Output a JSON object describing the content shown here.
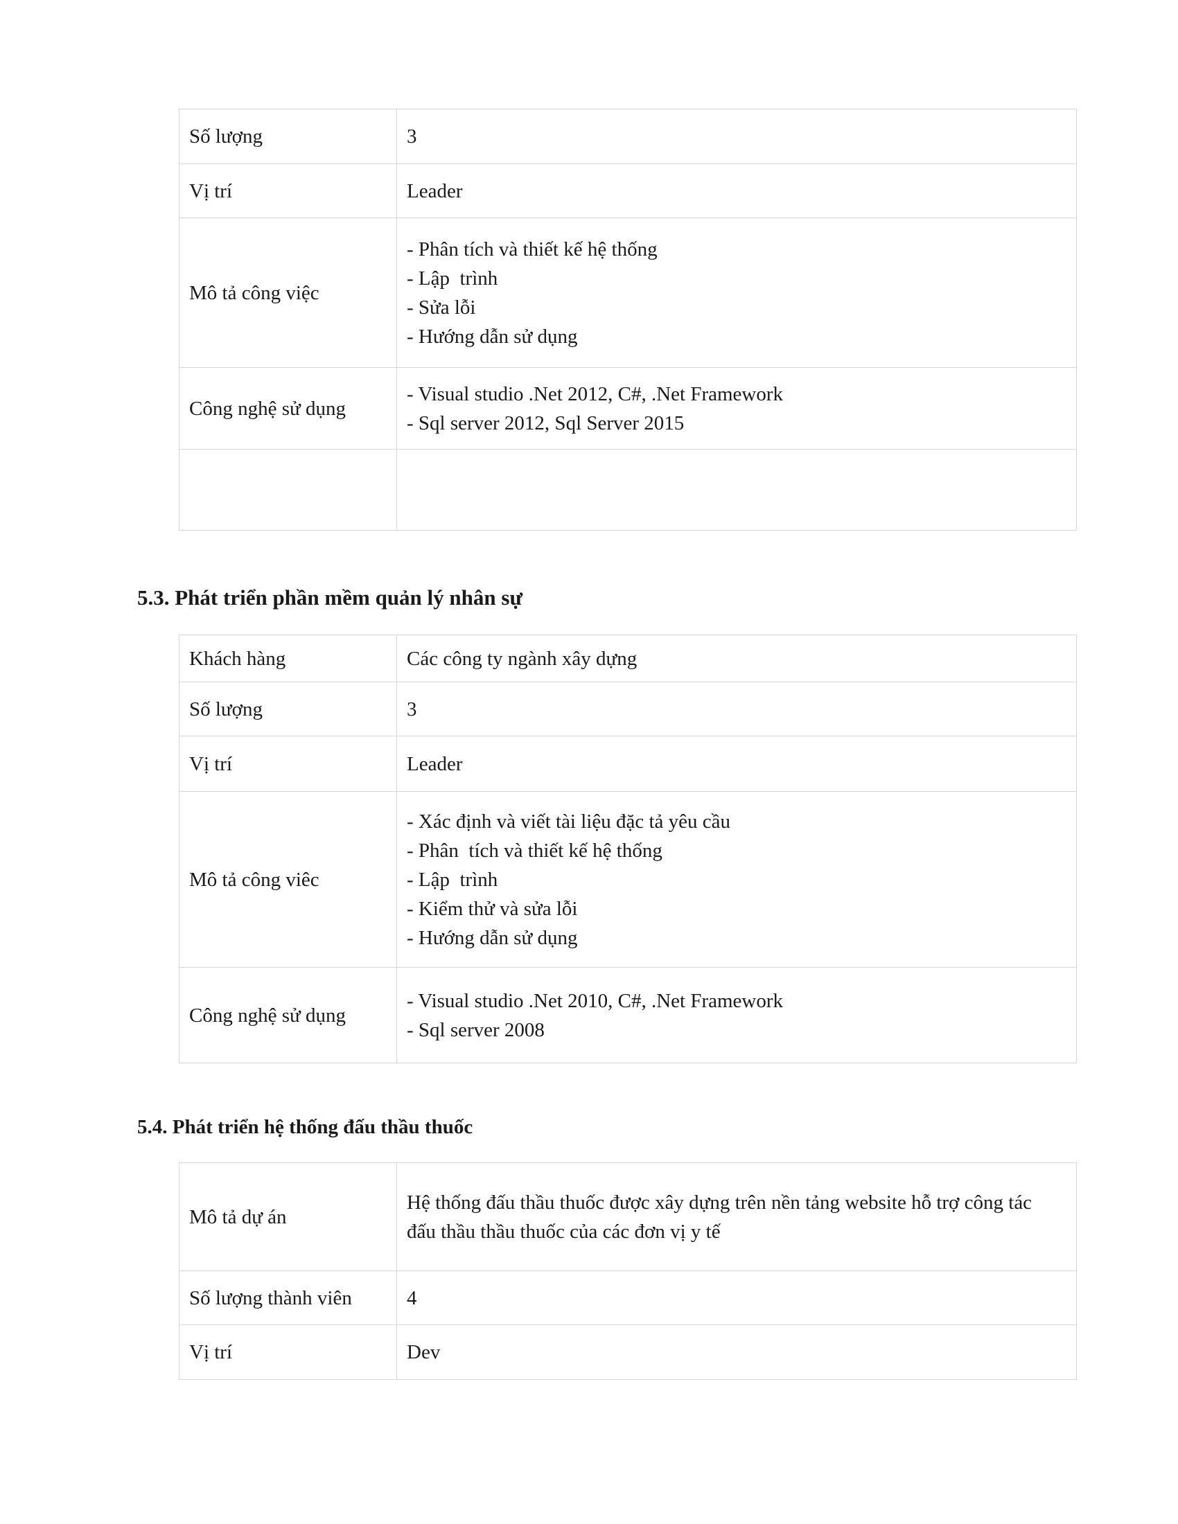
{
  "table1": {
    "rows": [
      {
        "label": "Số lượng",
        "value": [
          "3"
        ]
      },
      {
        "label": "Vị trí",
        "value": [
          "Leader"
        ]
      },
      {
        "label": "Mô tả công việc",
        "value": [
          "- Phân tích và thiết kế hệ thống",
          "- Lập  trình",
          "- Sửa lỗi",
          "- Hướng dẫn sử dụng"
        ]
      },
      {
        "label": "Công nghệ sử dụng",
        "value": [
          "- Visual studio .Net 2012, C#, .Net Framework",
          "- Sql server 2012, Sql Server 2015"
        ]
      },
      {
        "label": "",
        "value": [
          ""
        ]
      }
    ]
  },
  "section_5_3": {
    "heading": "5.3. Phát triển phần mềm quản lý nhân sự",
    "rows": [
      {
        "label": "Khách hàng",
        "value": [
          "Các công ty ngành xây dựng"
        ]
      },
      {
        "label": "Số lượng",
        "value": [
          "3"
        ]
      },
      {
        "label": "Vị trí",
        "value": [
          "Leader"
        ]
      },
      {
        "label": "Mô tả công viêc",
        "value": [
          "- Xác định và viết tài liệu đặc tả yêu cầu",
          "- Phân  tích và thiết kế hệ thống",
          "- Lập  trình",
          "- Kiểm thử và sửa lỗi",
          "- Hướng dẫn sử dụng"
        ]
      },
      {
        "label": "Công nghệ sử dụng",
        "value": [
          "- Visual studio .Net 2010, C#, .Net Framework",
          "- Sql server 2008"
        ]
      }
    ]
  },
  "section_5_4": {
    "heading": "5.4. Phát triển hệ thống đấu thầu thuốc",
    "rows": [
      {
        "label": "Mô tả dự án",
        "value": [
          "Hệ thống đấu thầu thuốc được xây dựng trên nền tảng website hỗ trợ công tác",
          "đấu thầu thầu thuốc của các đơn vị y tế"
        ]
      },
      {
        "label": "Số lượng thành viên",
        "value": [
          "4"
        ]
      },
      {
        "label": "Vị trí",
        "value": [
          "Dev"
        ]
      }
    ]
  }
}
